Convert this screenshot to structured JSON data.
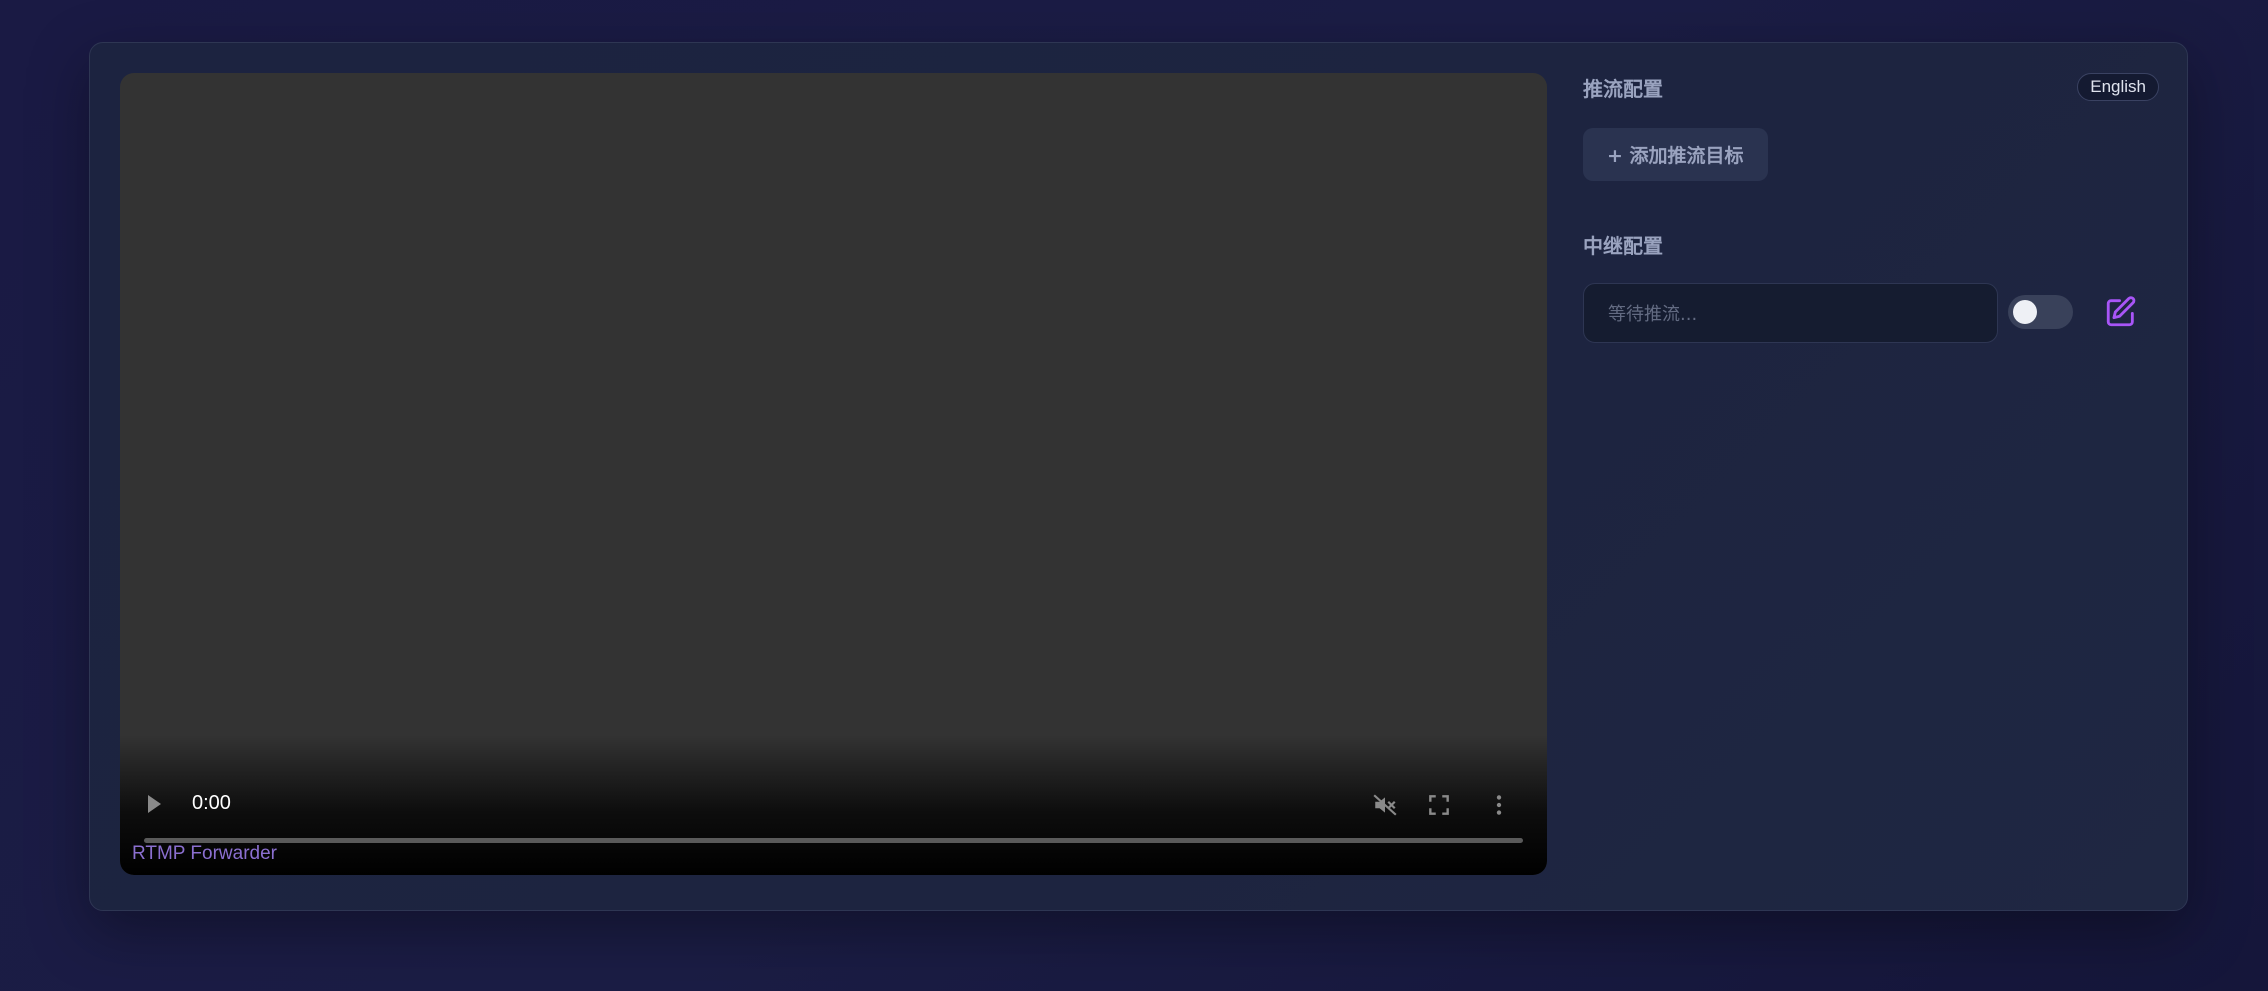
{
  "video": {
    "time": "0:00",
    "caption": "RTMP Forwarder",
    "progress": 0,
    "muted": true
  },
  "side": {
    "push_title": "推流配置",
    "language_button": "English",
    "add_target_button": "+ 添加推流目标",
    "relay_title": "中继配置",
    "relay_placeholder": "等待推流...",
    "relay_toggle_on": false
  },
  "icons": {
    "play": "play-icon",
    "mute": "volume-off-icon",
    "fullscreen": "fullscreen-icon",
    "more": "more-vert-icon",
    "edit": "edit-icon"
  },
  "colors": {
    "accent": "#a855f7",
    "caption": "#8b6fd0",
    "background": "#1a1a44",
    "panel": "#1d2440"
  }
}
